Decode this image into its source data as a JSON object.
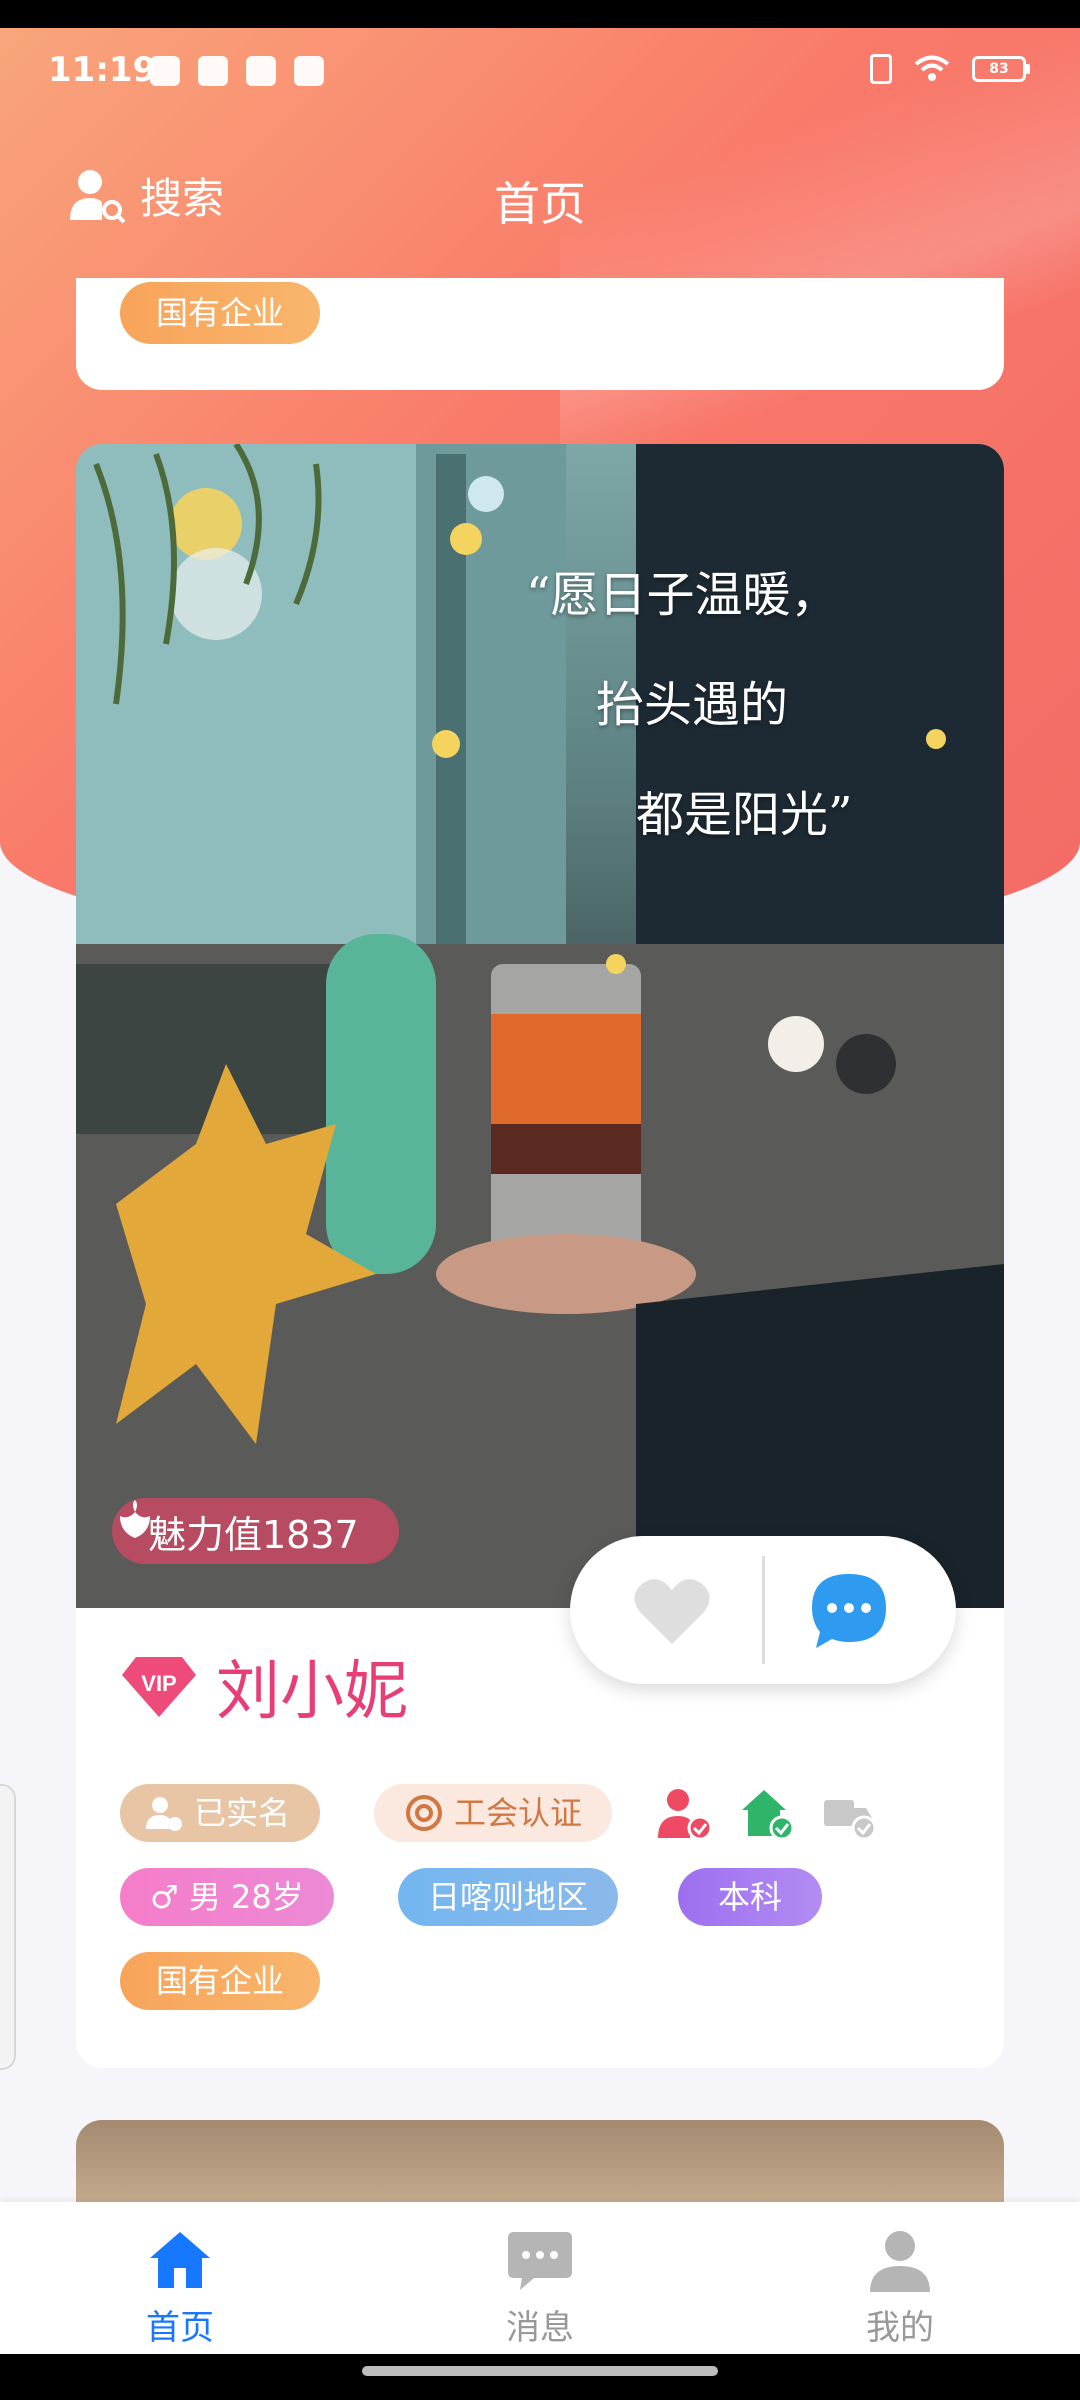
{
  "status_bar": {
    "time": "11:19",
    "battery": "83"
  },
  "header": {
    "search_label": "搜索",
    "title": "首页"
  },
  "prev_card": {
    "company_tag": "国有企业"
  },
  "card": {
    "quote_lines": [
      "“愿日子温暖，",
      "抬头遇的",
      "都是阳光”"
    ],
    "charm_label": "魅力值1837",
    "name": "刘小妮",
    "vip_text": "VIP",
    "tags": {
      "real_name": "已实名",
      "union": "工会认证",
      "gender_age": "♂ 男   28岁",
      "region": "日喀则地区",
      "education": "本科",
      "company": "国有企业"
    }
  },
  "bottom_nav": {
    "home": "首页",
    "messages": "消息",
    "me": "我的"
  },
  "colors": {
    "accent": "#1677ff",
    "brand_gradient_start": "#f9a57a",
    "brand_gradient_end": "#f36b66",
    "name_color": "#e73e76"
  }
}
